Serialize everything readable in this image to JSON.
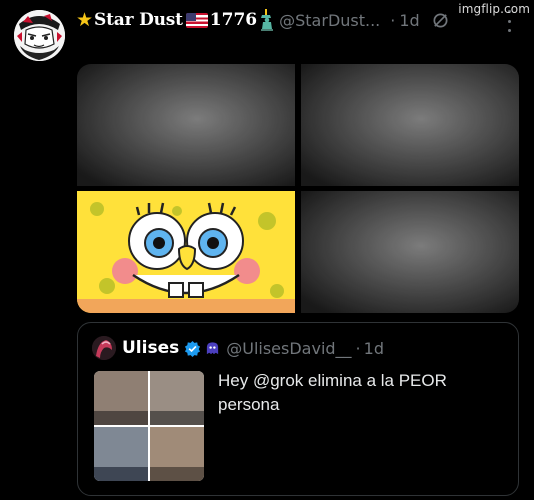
{
  "post": {
    "star_glyph": "★",
    "display_name": "Star Dust",
    "year_text": "1776",
    "handle": "@StarDust...",
    "dot": "·",
    "time": "1d",
    "watermark": "imgflip.com",
    "icons": {
      "flag": "us-flag-icon",
      "liberty": "statue-of-liberty-icon",
      "slash": "muted-slash-icon",
      "more": "more-icon"
    },
    "colors": {
      "star": "#f5c518",
      "muted_text": "#71767b",
      "background": "#000000"
    }
  },
  "media": {
    "tiles": [
      {
        "subject": "monochrome-face-photo"
      },
      {
        "subject": "monochrome-face-photo"
      },
      {
        "subject": "spongebob-cartoon"
      },
      {
        "subject": "monochrome-face-photo"
      }
    ]
  },
  "quote": {
    "display_name": "Ulises",
    "handle": "@UlisesDavid__",
    "dot": "·",
    "time": "1d",
    "text": "Hey @grok elimina a la PEOR persona",
    "icons": {
      "verified": "verified-badge-icon",
      "ghost": "ghost-icon"
    },
    "colors": {
      "verified": "#1d9bf0",
      "border": "#2f3336"
    },
    "photo_collage": [
      "person-photo",
      "person-photo",
      "person-photo",
      "person-photo"
    ]
  }
}
